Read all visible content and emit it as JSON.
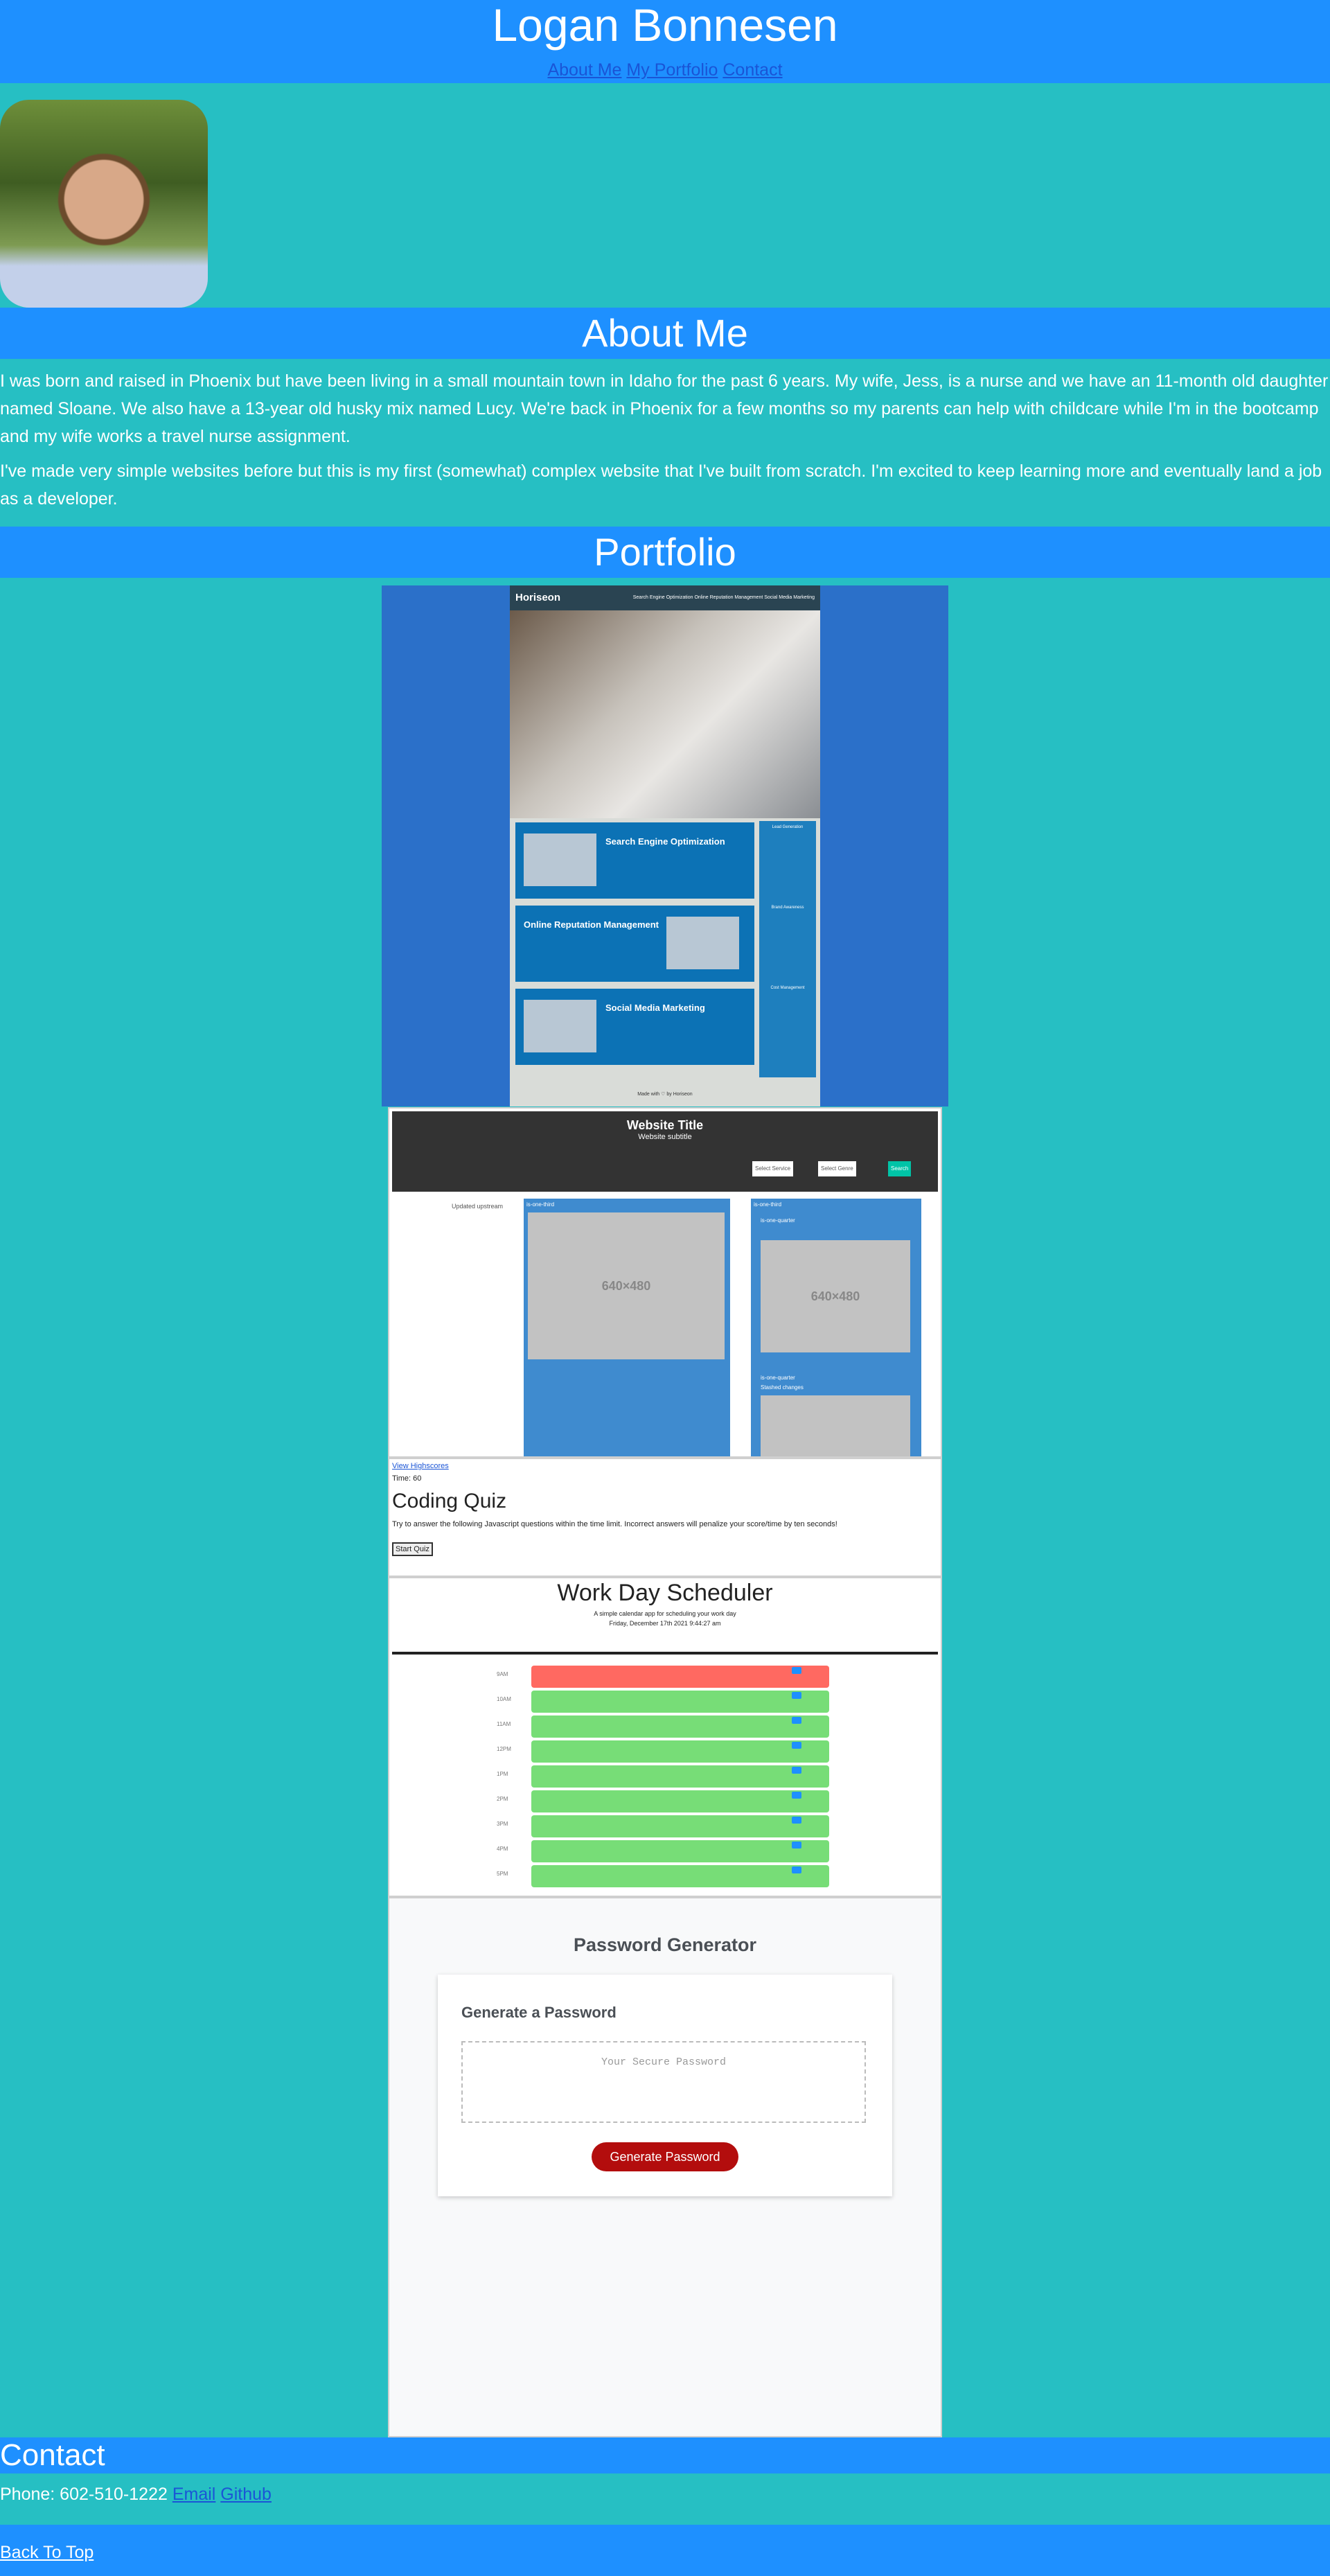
{
  "header": {
    "title": "Logan Bonnesen",
    "nav": [
      "About Me",
      "My Portfolio",
      "Contact"
    ]
  },
  "about": {
    "title": "About Me",
    "paragraphs": [
      "I was born and raised in Phoenix but have been living in a small mountain town in Idaho for the past 6 years. My wife, Jess, is a nurse and we have an 11-month old daughter named Sloane. We also have a 13-year old husky mix named Lucy. We're back in Phoenix for a few months so my parents can help with childcare while I'm in the bootcamp and my wife works a travel nurse assignment.",
      "I've made very simple websites before but this is my first (somewhat) complex website that I've built from scratch. I'm excited to keep learning more and eventually land a job as a developer."
    ]
  },
  "portfolio": {
    "title": "Portfolio",
    "horiseon": {
      "brand": "Hori",
      "brand_bold": "seon",
      "nav": "Search Engine Optimization   Online Reputation Management   Social Media Marketing",
      "boxes": [
        "Search Engine Optimization",
        "Online Reputation Management",
        "Social Media Marketing"
      ],
      "side": [
        "Lead Generation",
        "Brand Awareness",
        "Cost Management"
      ],
      "footer": "Made with ♡ by Horiseon"
    },
    "website_title": {
      "title": "Website Title",
      "subtitle": "Website subtitle",
      "select_service": "Select Service",
      "select_genre": "Select Genre",
      "search": "Search",
      "updated": "Updated upstream",
      "col1_label": "is-one-third",
      "col2_label": "is-one-third",
      "col2_sub": "is-one-quarter",
      "col2_sub2": "is-one-quarter",
      "stashed": "Stashed changes",
      "placeholder": "640×480"
    },
    "quiz": {
      "highscores": "View Highscores",
      "time": "Time: 60",
      "title": "Coding Quiz",
      "desc": "Try to answer the following Javascript questions within the time limit. Incorrect answers will penalize your score/time by ten seconds!",
      "start": "Start Quiz"
    },
    "scheduler": {
      "title": "Work Day Scheduler",
      "subtitle": "A simple calendar app for scheduling your work day",
      "date": "Friday, December 17th 2021 9:44:27 am",
      "hours": [
        "9AM",
        "10AM",
        "11AM",
        "12PM",
        "1PM",
        "2PM",
        "3PM",
        "4PM",
        "5PM"
      ],
      "past_color": "#ff6961",
      "future_color": "#77dd77"
    },
    "password": {
      "heading": "Password Generator",
      "card_title": "Generate a Password",
      "placeholder": "Your Secure Password",
      "button": "Generate Password",
      "button_color": "#b30d0d"
    }
  },
  "contact": {
    "title": "Contact",
    "phone": "Phone: 602-510-1222",
    "email": "Email",
    "github": "Github"
  },
  "footer": {
    "back_to_top": "Back To Top"
  },
  "colors": {
    "band": "#1e90ff",
    "background": "#26bfc3",
    "link": "#1a55d6"
  }
}
